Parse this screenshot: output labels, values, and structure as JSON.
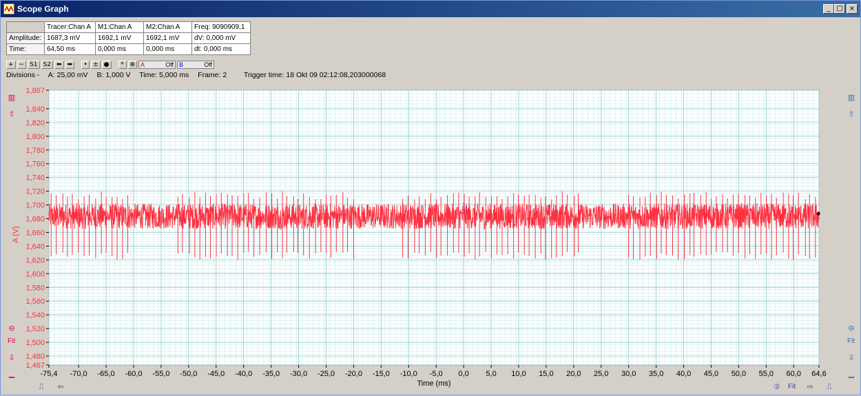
{
  "window": {
    "title": "Scope Graph",
    "minimize_glyph": "_",
    "maximize_glyph": "□",
    "close_glyph": "×"
  },
  "measurements": {
    "headers": [
      "",
      "Tracer:Chan A",
      "M1:Chan A",
      "M2:Chan A",
      "Freq: 9090909,1"
    ],
    "rows": [
      [
        "Amplitude:",
        "1687,3 mV",
        "1692,1 mV",
        "1692,1 mV",
        "dV: 0,000 mV"
      ],
      [
        "Time:",
        "64,50 ms",
        "0,000 ms",
        "0,000 ms",
        "dt:  0,000 ms"
      ]
    ]
  },
  "toolbar": {
    "buttons": [
      "+",
      "−",
      "S1",
      "S2",
      "⬅",
      "➡",
      "•",
      "±",
      "●",
      "*",
      "⊕"
    ],
    "chan_a_label": "A",
    "chan_a_state": "Off",
    "chan_b_label": "B",
    "chan_b_state": "Off"
  },
  "status": {
    "divisions": "Divisions -",
    "div_a": "A: 25,00 mV",
    "div_b": "B: 1,000 V",
    "time": "Time: 5,000 ms",
    "frame": "Frame: 2",
    "trigger": "Trigger time: 18 Okt 09 02:12:08,203000068"
  },
  "side_controls": {
    "fit_label": "Fit"
  },
  "bottom_controls": {
    "fit_label": "Fit"
  },
  "colors": {
    "trace": "#ff3040",
    "axis_text": "#ff3040",
    "grid_major": "#8fc9c9",
    "grid_minor": "#c9ecec",
    "plot_bg": "#ffffff",
    "marker": "#3a3aff"
  },
  "chart_data": {
    "type": "line",
    "title": "",
    "xlabel": "Time (ms)",
    "ylabel": "A (V)",
    "xlim": [
      -75.4,
      64.6
    ],
    "ylim": [
      1.467,
      1.867
    ],
    "grid": true,
    "x_ticks": [
      "-75,4",
      "-70,0",
      "-65,0",
      "-60,0",
      "-55,0",
      "-50,0",
      "-45,0",
      "-40,0",
      "-35,0",
      "-30,0",
      "-25,0",
      "-20,0",
      "-15,0",
      "-10,0",
      "-5,0",
      "0,0",
      "5,0",
      "10,0",
      "15,0",
      "20,0",
      "25,0",
      "30,0",
      "35,0",
      "40,0",
      "45,0",
      "50,0",
      "55,0",
      "60,0",
      "64,6"
    ],
    "x_tick_values": [
      -75.4,
      -70,
      -65,
      -60,
      -55,
      -50,
      -45,
      -40,
      -35,
      -30,
      -25,
      -20,
      -15,
      -10,
      -5,
      0,
      5,
      10,
      15,
      20,
      25,
      30,
      35,
      40,
      45,
      50,
      55,
      60,
      64.6
    ],
    "y_ticks": [
      "1,867",
      "1,840",
      "1,820",
      "1,800",
      "1,780",
      "1,760",
      "1,740",
      "1,720",
      "1,700",
      "1,680",
      "1,660",
      "1,640",
      "1,620",
      "1,600",
      "1,580",
      "1,560",
      "1,540",
      "1,520",
      "1,500",
      "1,480",
      "1,467"
    ],
    "y_tick_values": [
      1.867,
      1.84,
      1.82,
      1.8,
      1.78,
      1.76,
      1.74,
      1.72,
      1.7,
      1.68,
      1.66,
      1.64,
      1.62,
      1.6,
      1.58,
      1.56,
      1.54,
      1.52,
      1.5,
      1.48,
      1.467
    ],
    "series": [
      {
        "baseline": 1.683,
        "noise_band": [
          1.665,
          1.702
        ],
        "spike_max": 1.72,
        "spike_min": 1.62,
        "burst_intervals_ms": [
          [
            -75.4,
            -61.0
          ],
          [
            -52.0,
            -20.0
          ],
          [
            -11.0,
            21.0
          ],
          [
            30.0,
            64.6
          ]
        ]
      }
    ],
    "markers": [
      {
        "x": 0.0,
        "y": 1.7,
        "label": "1"
      },
      {
        "x": 0.0,
        "y": 1.69,
        "label": "2"
      }
    ],
    "tracer": {
      "x": 64.5,
      "y": 1.6873
    }
  }
}
